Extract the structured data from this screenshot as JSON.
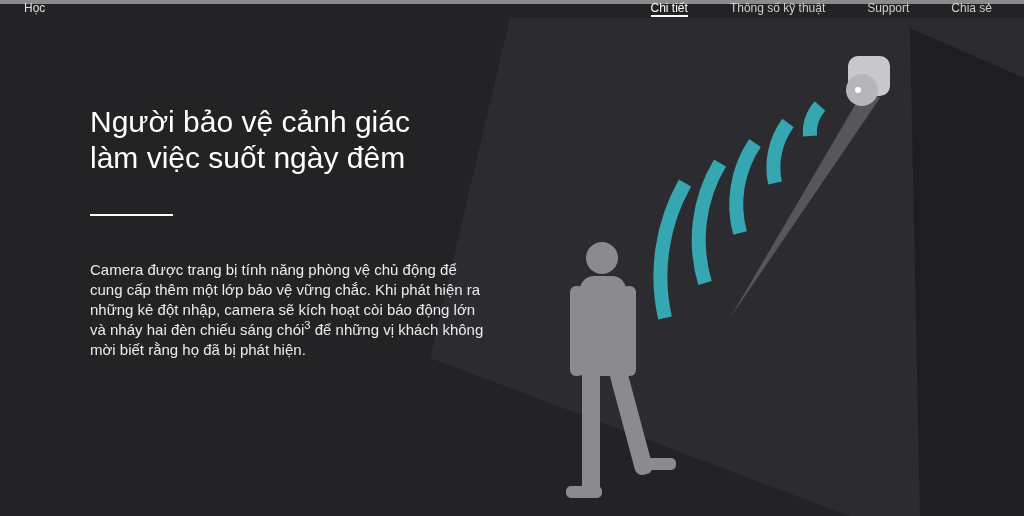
{
  "nav": {
    "left_item": "Học",
    "tabs": [
      {
        "label": "Chi tiết",
        "selected": true
      },
      {
        "label": "Thông số kỹ thuật",
        "selected": false
      },
      {
        "label": "Support",
        "selected": false
      },
      {
        "label": "Chia sẻ",
        "selected": false
      }
    ]
  },
  "hero": {
    "heading_lines": [
      "Người bảo vệ cảnh giác",
      "làm việc suốt ngày đêm"
    ],
    "body": "Camera được trang bị tính năng phòng vệ chủ động để cung cấp thêm một lớp bảo vệ vững chắc. Khi phát hiện ra những kẻ đột nhập, camera sẽ kích hoạt còi báo động lớn và nháy hai đèn chiếu sáng chói$^{3}$ để những vị khách không mời biết rằng họ đã bị phát hiện."
  }
}
